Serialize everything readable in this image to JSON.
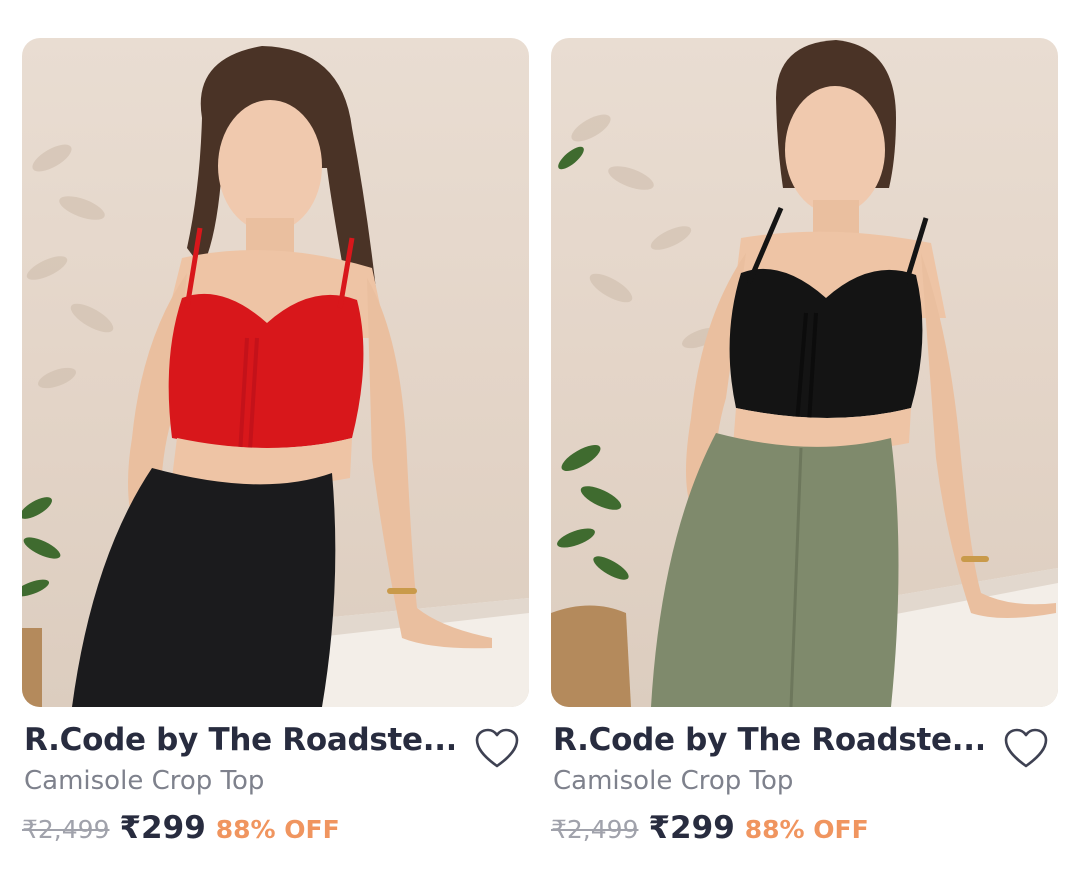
{
  "products": [
    {
      "brand": "R.Code by The Roadste...",
      "name": "Camisole Crop Top",
      "mrp": "₹2,499",
      "price": "₹299",
      "discount": "88% OFF",
      "image_icon": "product-photo-red-camisole",
      "top_color": "#d8171b",
      "pants_color": "#1b1b1d"
    },
    {
      "brand": "R.Code by The Roadste...",
      "name": "Camisole Crop Top",
      "mrp": "₹2,499",
      "price": "₹299",
      "discount": "88% OFF",
      "image_icon": "product-photo-black-camisole",
      "top_color": "#141414",
      "pants_color": "#7f8a6c"
    }
  ],
  "colors": {
    "brand_text": "#282c3f",
    "subtitle_text": "#7e818c",
    "mrp_text": "#a0a2ab",
    "discount_text": "#f0955f"
  },
  "icons": {
    "wishlist": "heart-outline-icon"
  }
}
